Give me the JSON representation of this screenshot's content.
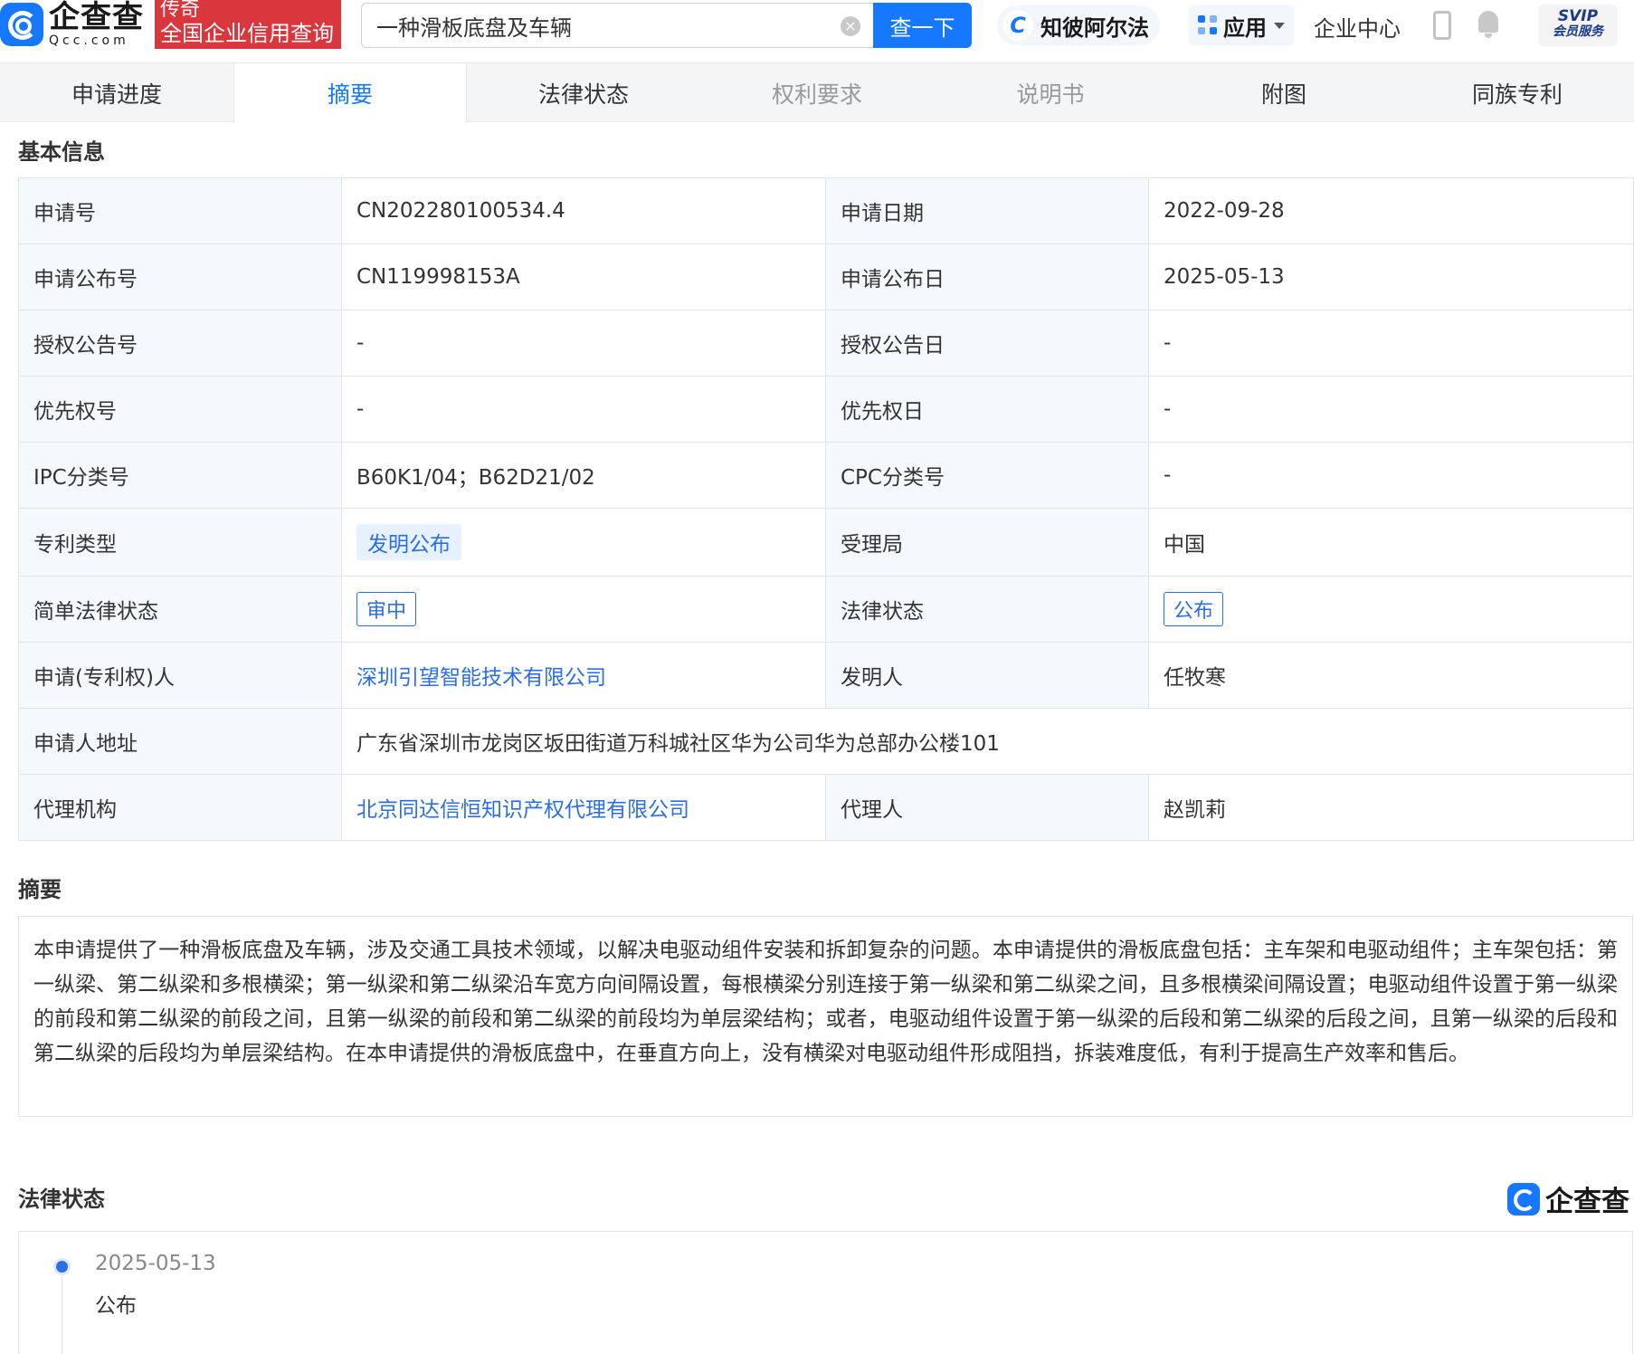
{
  "header": {
    "logo_cn": "企查查",
    "logo_en": "Qcc.com",
    "tag_line1": "传奇",
    "tag_line2": "全国企业信用查询",
    "search_value": "一种滑板底盘及车辆",
    "search_button": "查一下",
    "zbf_label": "知彼阿尔法",
    "apps_label": "应用",
    "enterprise_center": "企业中心",
    "svip_line1": "SVIP",
    "svip_line2": "会员服务"
  },
  "tabs": [
    {
      "label": "申请进度",
      "state": "normal"
    },
    {
      "label": "摘要",
      "state": "active"
    },
    {
      "label": "法律状态",
      "state": "normal"
    },
    {
      "label": "权利要求",
      "state": "disabled"
    },
    {
      "label": "说明书",
      "state": "disabled"
    },
    {
      "label": "附图",
      "state": "normal"
    },
    {
      "label": "同族专利",
      "state": "normal"
    }
  ],
  "basic_info": {
    "title": "基本信息",
    "rows": [
      {
        "l1": "申请号",
        "v1": "CN202280100534.4",
        "l2": "申请日期",
        "v2": "2022-09-28"
      },
      {
        "l1": "申请公布号",
        "v1": "CN119998153A",
        "l2": "申请公布日",
        "v2": "2025-05-13"
      },
      {
        "l1": "授权公告号",
        "v1": "-",
        "l2": "授权公告日",
        "v2": "-"
      },
      {
        "l1": "优先权号",
        "v1": "-",
        "l2": "优先权日",
        "v2": "-"
      },
      {
        "l1": "IPC分类号",
        "v1": "B60K1/04；B62D21/02",
        "l2": "CPC分类号",
        "v2": "-"
      },
      {
        "l1": "专利类型",
        "v1": "发明公布",
        "l2": "受理局",
        "v2": "中国"
      },
      {
        "l1": "简单法律状态",
        "v1": "审中",
        "l2": "法律状态",
        "v2": "公布"
      },
      {
        "l1": "申请(专利权)人",
        "v1": "深圳引望智能技术有限公司",
        "l2": "发明人",
        "v2": "任牧寒"
      },
      {
        "l1": "申请人地址",
        "v1": "广东省深圳市龙岗区坂田街道万科城社区华为公司华为总部办公楼101"
      },
      {
        "l1": "代理机构",
        "v1": "北京同达信恒知识产权代理有限公司",
        "l2": "代理人",
        "v2": "赵凯莉"
      }
    ]
  },
  "abstract": {
    "title": "摘要",
    "text": "本申请提供了一种滑板底盘及车辆，涉及交通工具技术领域，以解决电驱动组件安装和拆卸复杂的问题。本申请提供的滑板底盘包括：主车架和电驱动组件；主车架包括：第一纵梁、第二纵梁和多根横梁；第一纵梁和第二纵梁沿车宽方向间隔设置，每根横梁分别连接于第一纵梁和第二纵梁之间，且多根横梁间隔设置；电驱动组件设置于第一纵梁的前段和第二纵梁的前段之间，且第一纵梁的前段和第二纵梁的前段均为单层梁结构；或者，电驱动组件设置于第一纵梁的后段和第二纵梁的后段之间，且第一纵梁的后段和第二纵梁的后段均为单层梁结构。在本申请提供的滑板底盘中，在垂直方向上，没有横梁对电驱动组件形成阻挡，拆装难度低，有利于提高生产效率和售后。"
  },
  "legal_status": {
    "title": "法律状态",
    "brand": "企查查",
    "events": [
      {
        "date": "2025-05-13",
        "status": "公布"
      }
    ]
  },
  "colors": {
    "brand_blue": "#1677ff",
    "link_blue": "#2b6fe0",
    "tag_red": "#d9363e",
    "label_bg": "#f5f8fc"
  }
}
